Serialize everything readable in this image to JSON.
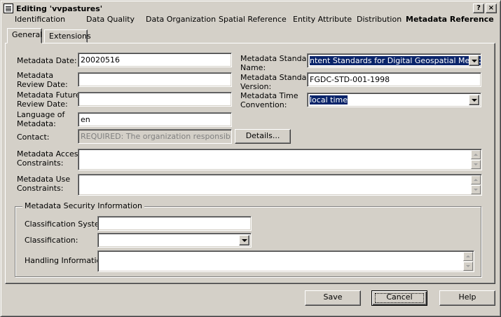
{
  "window": {
    "title": "Editing 'vvpastures'",
    "help_btn": "?",
    "close_btn": "×"
  },
  "top_tabs": [
    {
      "label": "Identification"
    },
    {
      "label": "Data Quality"
    },
    {
      "label": "Data Organization"
    },
    {
      "label": "Spatial Reference"
    },
    {
      "label": "Entity Attribute"
    },
    {
      "label": "Distribution"
    },
    {
      "label": "Metadata Reference"
    }
  ],
  "sub_tabs": [
    {
      "label": "General"
    },
    {
      "label": "Extensions"
    }
  ],
  "form": {
    "metadata_date": {
      "label": "Metadata Date:",
      "value": "20020516"
    },
    "review_date": {
      "label1": "Metadata",
      "label2": "Review Date:",
      "value": ""
    },
    "future_review_date": {
      "label1": "Metadata Future",
      "label2": "Review Date:",
      "value": ""
    },
    "language": {
      "label1": "Language of",
      "label2": "Metadata:",
      "value": "en"
    },
    "contact": {
      "label": "Contact:",
      "value": "REQUIRED: The organization responsible for",
      "details_button": "Details..."
    },
    "standard_name": {
      "label1": "Metadata Standard",
      "label2": "Name:",
      "value": "ntent Standards for Digital Geospatial Metadata"
    },
    "standard_version": {
      "label1": "Metadata Standard",
      "label2": "Version:",
      "value": "FGDC-STD-001-1998"
    },
    "time_convention": {
      "label1": "Metadata Time",
      "label2": "Convention:",
      "value": "local time"
    },
    "access_constraints": {
      "label1": "Metadata Access",
      "label2": "Constraints:",
      "value": ""
    },
    "use_constraints": {
      "label1": "Metadata Use",
      "label2": "Constraints:",
      "value": ""
    }
  },
  "security": {
    "group_title": "Metadata Security Information",
    "classification_system": {
      "label": "Classification System:",
      "value": ""
    },
    "classification": {
      "label": "Classification:",
      "value": ""
    },
    "handling": {
      "label": "Handling Information:",
      "value": ""
    }
  },
  "buttons": {
    "save": "Save",
    "cancel": "Cancel",
    "help": "Help"
  }
}
